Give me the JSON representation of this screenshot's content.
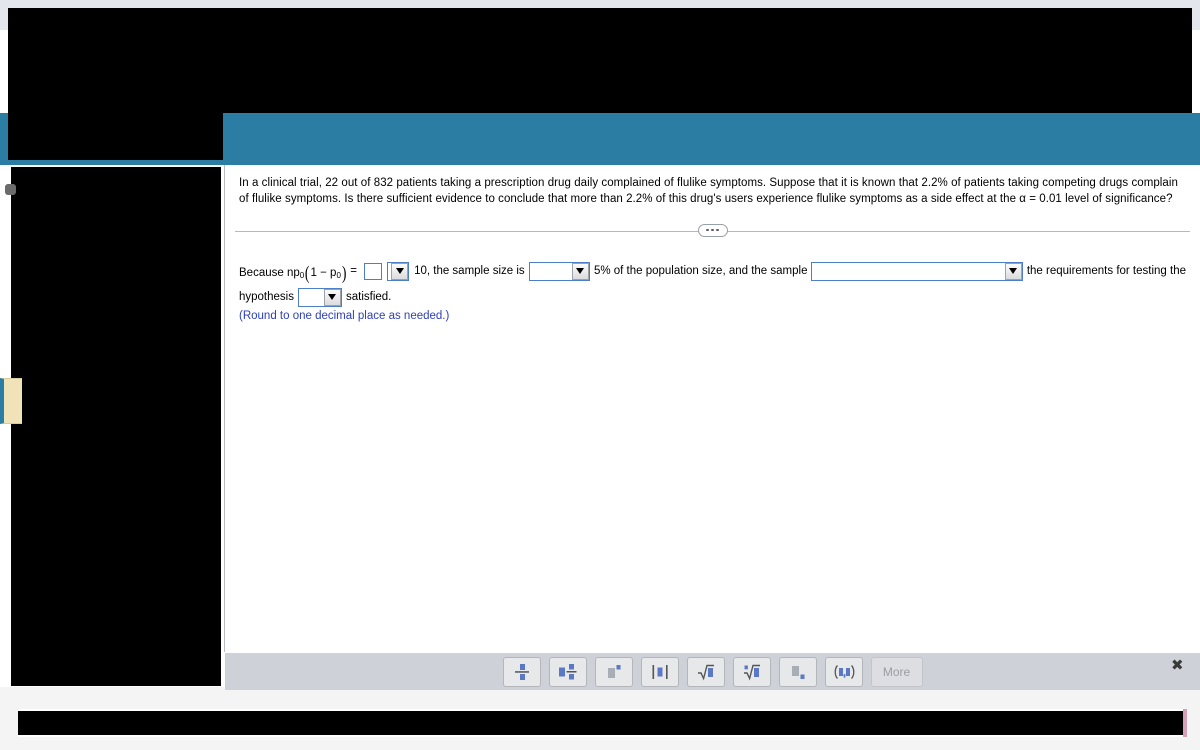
{
  "question": {
    "text": "In a clinical trial, 22 out of 832 patients taking a prescription drug daily complained of flulike symptoms. Suppose that it is known that 2.2% of patients taking competing drugs complain of flulike symptoms. Is there sufficient evidence to conclude that more than 2.2% of this drug's users experience flulike symptoms as a side effect at the α = 0.01 level of significance?",
    "expand_button": "..."
  },
  "answer": {
    "prefix": "Because np",
    "sub_one": "0",
    "open_paren": "(",
    "inner": "1 − p",
    "sub_two": "0",
    "close_paren": ")",
    "equals": "=",
    "blank_value": "",
    "threshold": "10, the sample size is",
    "dd_compare_value": "",
    "mid_text": "5% of the population size, and the sample",
    "dd_requirements_value": "",
    "tail_text": "the requirements for testing the",
    "hypothesis_label": "hypothesis",
    "dd_satisfied_value": "",
    "satisfied_label": "satisfied.",
    "round_note": "(Round to one decimal place as needed.)"
  },
  "palette": {
    "buttons": [
      {
        "name": "fraction-button",
        "label": ""
      },
      {
        "name": "mixed-fraction-button",
        "label": ""
      },
      {
        "name": "superscript-button",
        "label": ""
      },
      {
        "name": "absolute-value-button",
        "label": ""
      },
      {
        "name": "square-root-button",
        "label": ""
      },
      {
        "name": "nth-root-button",
        "label": ""
      },
      {
        "name": "subscript-button",
        "label": ""
      },
      {
        "name": "ordered-pair-button",
        "label": ""
      }
    ],
    "more_label": "More",
    "close_label": "✖"
  },
  "colors": {
    "accent_teal": "#2b7da3",
    "input_border_blue": "#4d7ec8",
    "note_blue": "#2b3fb8",
    "toolbar_gray": "#ced1d7"
  }
}
